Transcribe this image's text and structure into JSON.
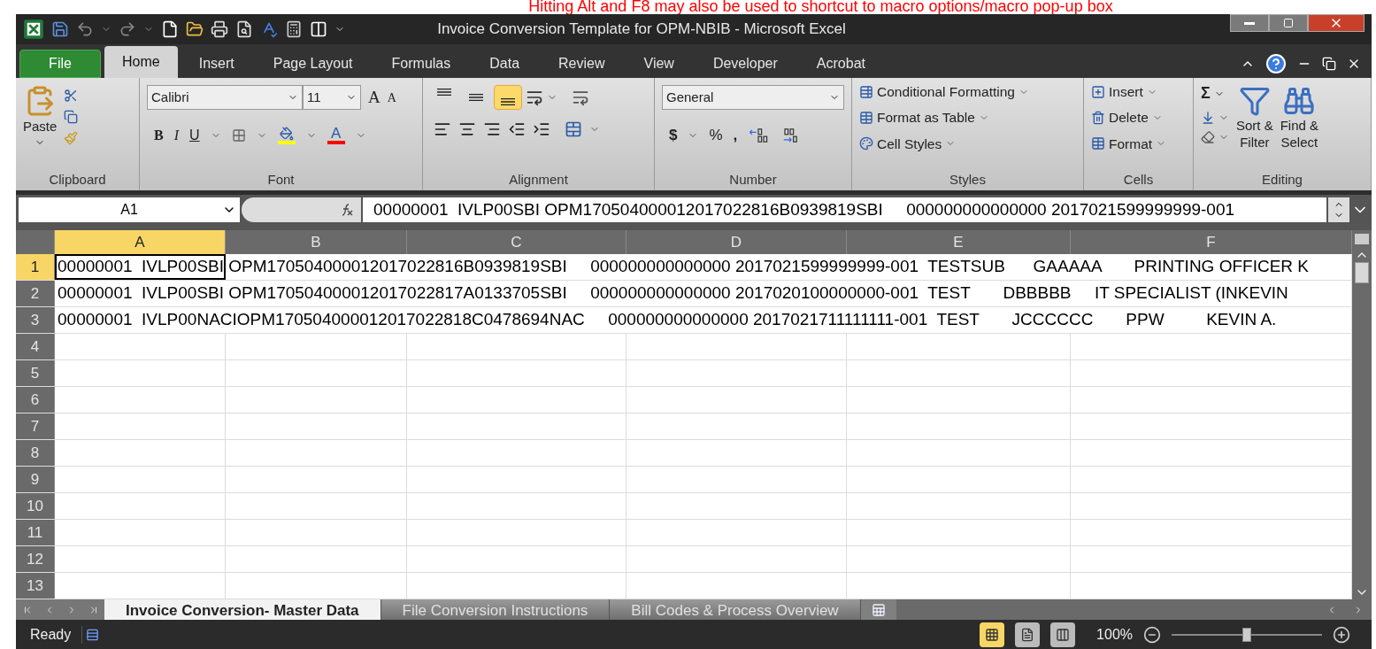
{
  "banner": "Hitting Alt and F8 may also be used to shortcut to macro options/macro pop-up box",
  "window": {
    "title": "Invoice Conversion Template for OPM-NBIB  -  Microsoft Excel"
  },
  "ribbon_tabs": [
    {
      "label": "File",
      "kind": "file",
      "selected": false
    },
    {
      "label": "Home",
      "kind": "tab",
      "selected": true
    },
    {
      "label": "Insert",
      "kind": "tab",
      "selected": false
    },
    {
      "label": "Page Layout",
      "kind": "tab",
      "selected": false
    },
    {
      "label": "Formulas",
      "kind": "tab",
      "selected": false
    },
    {
      "label": "Data",
      "kind": "tab",
      "selected": false
    },
    {
      "label": "Review",
      "kind": "tab",
      "selected": false
    },
    {
      "label": "View",
      "kind": "tab",
      "selected": false
    },
    {
      "label": "Developer",
      "kind": "tab",
      "selected": false
    },
    {
      "label": "Acrobat",
      "kind": "tab",
      "selected": false
    }
  ],
  "clipboard": {
    "paste": "Paste",
    "label": "Clipboard"
  },
  "font": {
    "name": "Calibri",
    "size": "11",
    "grow": "A",
    "shrink": "A",
    "bold": "B",
    "italic": "I",
    "underline": "U",
    "color_letter": "A",
    "label": "Font"
  },
  "alignment": {
    "vertical": [
      {
        "kind": "top",
        "selected": false
      },
      {
        "kind": "middle",
        "selected": false
      },
      {
        "kind": "bottom",
        "selected": true
      }
    ],
    "label": "Alignment"
  },
  "number": {
    "format": "General",
    "currency": "$",
    "percent": "%",
    "comma": ",",
    "label": "Number"
  },
  "styles": {
    "items": [
      "Conditional Formatting",
      "Format as Table",
      "Cell Styles"
    ],
    "label": "Styles"
  },
  "cells": {
    "items": [
      "Insert",
      "Delete",
      "Format"
    ],
    "label": "Cells"
  },
  "editing": {
    "sigma": "Σ",
    "buttons": [
      [
        "Sort &",
        "Filter"
      ],
      [
        "Find &",
        "Select"
      ]
    ],
    "label": "Editing"
  },
  "formula_bar": {
    "name_box": "A1",
    "value": "00000001  IVLP00SBI OPM170504000012017022816B0939819SBI     000000000000000 2017021599999999-001"
  },
  "columns": [
    {
      "label": "A",
      "selected": true
    },
    {
      "label": "B",
      "selected": false
    },
    {
      "label": "C",
      "selected": false
    },
    {
      "label": "D",
      "selected": false
    },
    {
      "label": "E",
      "selected": false
    },
    {
      "label": "F",
      "selected": false
    }
  ],
  "rows": [
    {
      "header": "1",
      "selected": true,
      "text": "00000001  IVLP00SBI OPM170504000012017022816B0939819SBI     000000000000000 2017021599999999-001  TESTSUB      GAAAAA       PRINTING OFFICER K"
    },
    {
      "header": "2",
      "selected": false,
      "text": "00000001  IVLP00SBI OPM170504000012017022817A0133705SBI     000000000000000 2017020100000000-001  TEST       DBBBBB     IT SPECIALIST (INKEVIN"
    },
    {
      "header": "3",
      "selected": false,
      "text": "00000001  IVLP00NACIOPM170504000012017022818C0478694NAC     000000000000000 2017021711111111-001  TEST       JCCCCCC       PPW         KEVIN A."
    },
    {
      "header": "4",
      "selected": false
    },
    {
      "header": "5",
      "selected": false
    },
    {
      "header": "6",
      "selected": false
    },
    {
      "header": "7",
      "selected": false
    },
    {
      "header": "8",
      "selected": false
    },
    {
      "header": "9",
      "selected": false
    },
    {
      "header": "10",
      "selected": false
    },
    {
      "header": "11",
      "selected": false
    },
    {
      "header": "12",
      "selected": false
    },
    {
      "header": "13",
      "selected": false
    }
  ],
  "sheet_tabs": [
    {
      "label": "Invoice Conversion- Master Data",
      "selected": true
    },
    {
      "label": "File Conversion Instructions",
      "selected": false
    },
    {
      "label": "Bill Codes & Process Overview",
      "selected": false
    }
  ],
  "status": {
    "text": "Ready",
    "zoom": "100%",
    "level": 0.5,
    "views": [
      {
        "kind": "normal",
        "selected": true
      },
      {
        "kind": "page-layout",
        "selected": false
      },
      {
        "kind": "page-break",
        "selected": false
      }
    ]
  }
}
